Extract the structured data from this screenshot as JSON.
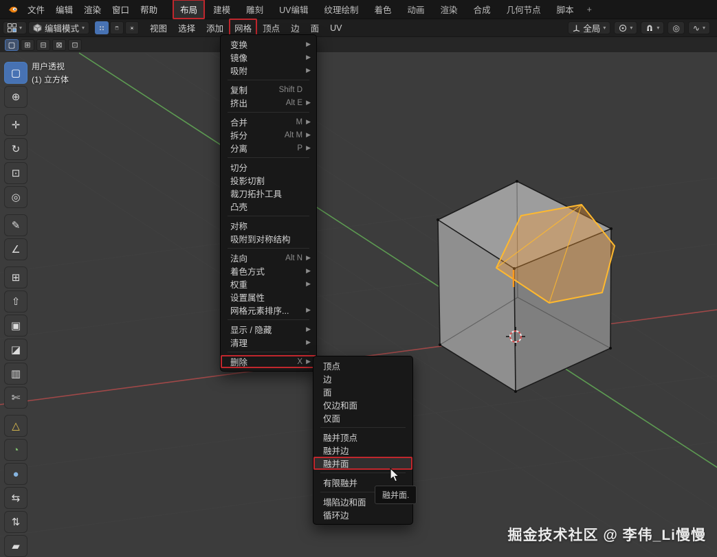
{
  "topbar": {
    "app_menus": [
      "文件",
      "编辑",
      "渲染",
      "窗口",
      "帮助"
    ],
    "workspace_tabs": [
      {
        "label": "布局",
        "active": true,
        "boxed": true
      },
      {
        "label": "建模"
      },
      {
        "label": "雕刻"
      },
      {
        "label": "UV编辑"
      },
      {
        "label": "纹理绘制"
      },
      {
        "label": "着色"
      },
      {
        "label": "动画"
      },
      {
        "label": "渲染"
      },
      {
        "label": "合成"
      },
      {
        "label": "几何节点"
      },
      {
        "label": "脚本"
      }
    ],
    "add_tab": "+"
  },
  "header": {
    "mode_label": "编辑模式",
    "menus": [
      {
        "label": "视图"
      },
      {
        "label": "选择"
      },
      {
        "label": "添加"
      },
      {
        "label": "网格",
        "boxed": true
      },
      {
        "label": "顶点"
      },
      {
        "label": "边"
      },
      {
        "label": "面"
      },
      {
        "label": "UV"
      }
    ],
    "orientation_label": "全局",
    "falloff_glyph": "∿"
  },
  "tool_settings": {
    "select_modes": [
      {
        "name": "set",
        "glyph": "▢",
        "active": true
      },
      {
        "name": "extend",
        "glyph": "⊞"
      },
      {
        "name": "subtract",
        "glyph": "⊟"
      },
      {
        "name": "invert",
        "glyph": "⊠"
      },
      {
        "name": "intersect",
        "glyph": "⊡"
      }
    ]
  },
  "toolbar": {
    "tools": [
      {
        "name": "select-box",
        "glyph": "▢",
        "active": true
      },
      {
        "name": "cursor",
        "glyph": "⊕"
      },
      {
        "name": "move",
        "glyph": "✛",
        "gap": true
      },
      {
        "name": "rotate",
        "glyph": "↻"
      },
      {
        "name": "scale",
        "glyph": "⊡"
      },
      {
        "name": "transform",
        "glyph": "◎"
      },
      {
        "name": "annotate",
        "glyph": "✎",
        "gap": true
      },
      {
        "name": "measure",
        "glyph": "∠"
      },
      {
        "name": "add-cube",
        "glyph": "⊞",
        "gap": true
      },
      {
        "name": "extrude-region",
        "glyph": "⇧"
      },
      {
        "name": "inset-faces",
        "glyph": "▣"
      },
      {
        "name": "bevel",
        "glyph": "◪"
      },
      {
        "name": "loop-cut",
        "glyph": "▥"
      },
      {
        "name": "knife",
        "glyph": "✄"
      },
      {
        "name": "poly-build",
        "glyph": "△",
        "color": "#e2c14e",
        "gap": true
      },
      {
        "name": "spin",
        "glyph": "◔",
        "color": "#7fbf6e"
      },
      {
        "name": "smooth",
        "glyph": "●",
        "color": "#86b4e0"
      },
      {
        "name": "edge-slide",
        "glyph": "⇆"
      },
      {
        "name": "shrink-fatten",
        "glyph": "⇅"
      },
      {
        "name": "shear",
        "glyph": "▰"
      }
    ]
  },
  "viewport": {
    "overlay_view": "用户透视",
    "overlay_object": "(1) 立方体",
    "watermark": "掘金技术社区 @ 李伟_Li慢慢"
  },
  "mesh_menu": {
    "title": "网格",
    "items": [
      {
        "label": "变换",
        "submenu": true
      },
      {
        "label": "镜像",
        "submenu": true
      },
      {
        "label": "吸附",
        "submenu": true
      },
      {
        "sep": true
      },
      {
        "label": "复制",
        "shortcut": "Shift D"
      },
      {
        "label": "挤出",
        "shortcut": "Alt E",
        "submenu": true
      },
      {
        "sep": true
      },
      {
        "label": "合并",
        "shortcut": "M",
        "submenu": true
      },
      {
        "label": "拆分",
        "shortcut": "Alt M",
        "submenu": true
      },
      {
        "label": "分离",
        "shortcut": "P",
        "submenu": true
      },
      {
        "sep": true
      },
      {
        "label": "切分"
      },
      {
        "label": "投影切割"
      },
      {
        "label": "裁刀拓扑工具"
      },
      {
        "label": "凸壳"
      },
      {
        "sep": true
      },
      {
        "label": "对称"
      },
      {
        "label": "吸附到对称结构"
      },
      {
        "sep": true
      },
      {
        "label": "法向",
        "shortcut": "Alt N",
        "submenu": true
      },
      {
        "label": "着色方式",
        "submenu": true
      },
      {
        "label": "权重",
        "submenu": true
      },
      {
        "label": "设置属性"
      },
      {
        "label": "网格元素排序...",
        "submenu": true
      },
      {
        "sep": true
      },
      {
        "label": "显示 / 隐藏",
        "submenu": true
      },
      {
        "label": "清理",
        "submenu": true
      },
      {
        "sep": true
      },
      {
        "label": "删除",
        "shortcut": "X",
        "submenu": true,
        "boxed": true
      }
    ]
  },
  "delete_submenu": {
    "parent": "删除",
    "items": [
      {
        "label": "顶点"
      },
      {
        "label": "边"
      },
      {
        "label": "面"
      },
      {
        "label": "仅边和面"
      },
      {
        "label": "仅面"
      },
      {
        "sep": true
      },
      {
        "label": "融并顶点"
      },
      {
        "label": "融并边"
      },
      {
        "label": "融并面",
        "boxed": true,
        "hover": true
      },
      {
        "sep": true
      },
      {
        "label": "有限融并"
      },
      {
        "sep": true
      },
      {
        "label": "塌陷边和面"
      },
      {
        "label": "循环边"
      }
    ],
    "tooltip": "融并面."
  },
  "colors": {
    "accent_blue": "#4772b3",
    "annotation_red": "#c1272d",
    "selection_orange": "#ffb92e",
    "axis_red": "#a04848",
    "axis_green": "#5d9b52"
  }
}
